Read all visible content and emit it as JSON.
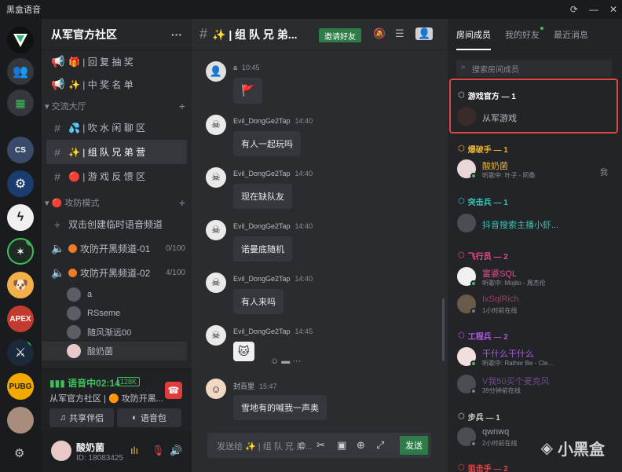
{
  "window": {
    "title": "黑盒语音",
    "controls": [
      "refresh-icon",
      "minimize-icon",
      "close-icon"
    ]
  },
  "rail": {
    "servers": [
      {
        "name": "heybox-logo",
        "bg": "#111"
      },
      {
        "name": "friends",
        "bg": "#35373c"
      },
      {
        "name": "game-lobby",
        "bg": "#35373c"
      },
      {
        "name": "cs",
        "bg": "#3a4a6a"
      },
      {
        "name": "steam",
        "bg": "#1b3c6e"
      },
      {
        "name": "lightning",
        "bg": "#f0f0f0"
      },
      {
        "name": "congjun",
        "bg": "#1f2a22"
      },
      {
        "name": "doge",
        "bg": "#f3b04a"
      },
      {
        "name": "apex",
        "bg": "#c33a2e"
      },
      {
        "name": "destiny",
        "bg": "#1a2a3a"
      },
      {
        "name": "pubg",
        "bg": "#f2a900"
      },
      {
        "name": "portrait",
        "bg": "#a88d7d"
      }
    ],
    "apex_label": "APEX",
    "pubg_label": "PUBG"
  },
  "channels": {
    "server_title": "从军官方社区",
    "more": "···",
    "items": [
      {
        "label": "🎁 | 回 复 抽 奖",
        "type": "text"
      },
      {
        "label": "✨ | 中 奖 名 单",
        "type": "text"
      }
    ],
    "cat_hall": "交流大厅",
    "hall": [
      {
        "label": "💦 | 吹 水 闲 聊 区"
      },
      {
        "label": "✨ | 组 队 兄 弟 营"
      },
      {
        "label": "🔴 | 游 戏 反 馈 区"
      }
    ],
    "cat_attack": "攻防模式",
    "create_temp": "双击创建临时语音频道",
    "voice1": {
      "label": "攻防开黑频道-01",
      "count": "0/100"
    },
    "voice2": {
      "label": "攻防开黑频道-02",
      "count": "4/100"
    },
    "members": [
      "a",
      "RSseme",
      "随风渐远00",
      "酸奶菌"
    ]
  },
  "voice": {
    "status": "语音中02:14",
    "kbps": "128K",
    "location": "从军官方社区 | 🟠 攻防开黑...",
    "share": "共享伴侣",
    "pack": "语音包"
  },
  "user": {
    "name": "酸奶菌",
    "id": "ID: 18083425"
  },
  "chat": {
    "channel": "✨ | 组 队 兄 弟...",
    "invite": "邀请好友",
    "input_placeholder": "发送给 ✨ | 组 队 兄 弟...",
    "send": "发送",
    "messages": [
      {
        "user": "a",
        "time": "10:45",
        "text": "🚩"
      },
      {
        "user": "Evil_DongGe2Tap",
        "time": "14:40",
        "text": "有人一起玩吗"
      },
      {
        "user": "Evil_DongGe2Tap",
        "time": "14:40",
        "text": "现在缺队友"
      },
      {
        "user": "Evil_DongGe2Tap",
        "time": "14:40",
        "text": "诺曼底随机"
      },
      {
        "user": "Evil_DongGe2Tap",
        "time": "14:40",
        "text": "有人来吗"
      },
      {
        "user": "Evil_DongGe2Tap",
        "time": "14:45",
        "text": "🐱"
      },
      {
        "user": "封百里",
        "time": "15:47",
        "text": "雪地有的喊我一声奥"
      }
    ]
  },
  "right": {
    "tabs": [
      "房间成员",
      "我的好友",
      "最近消息"
    ],
    "search_placeholder": "搜索房间成员",
    "groups": [
      {
        "title": "游戏官方 — 1",
        "color": "#ffffff",
        "members": [
          {
            "name": "从军游戏",
            "status": "",
            "color": "#b8bbbf",
            "online": false
          }
        ]
      },
      {
        "title": "爆破手 — 1",
        "color": "#e8b43c",
        "members": [
          {
            "name": "酸奶菌",
            "status": "听歌中: 叶子 - 阿桑",
            "color": "#e8b43c",
            "online": true
          }
        ]
      },
      {
        "title": "突击兵 — 1",
        "color": "#3cc1b4",
        "members": [
          {
            "name": "抖音搜索主播小虾...",
            "status": "",
            "color": "#3cc1b4",
            "online": false
          }
        ]
      },
      {
        "title": "飞行员 — 2",
        "color": "#e0508a",
        "members": [
          {
            "name": "富婆SQL",
            "status": "听歌中: Mojito - 周杰伦",
            "color": "#e0508a",
            "online": true
          },
          {
            "name": "IxSqlRich",
            "status": "1小时前在线",
            "color": "#9b3c63",
            "online": false
          }
        ]
      },
      {
        "title": "工程兵 — 2",
        "color": "#a65cd8",
        "members": [
          {
            "name": "干什么干什么",
            "status": "听歌中: Rather Be - Cle...",
            "color": "#a65cd8",
            "online": true
          },
          {
            "name": "V我50买个麦克风",
            "status": "39分钟前在线",
            "color": "#6d4b86",
            "online": false
          }
        ]
      },
      {
        "title": "步兵 — 1",
        "color": "#d0d2d5",
        "members": [
          {
            "name": "qwnwq",
            "status": "2小时前在线",
            "color": "#9a9da2",
            "online": false
          }
        ]
      },
      {
        "title": "狙击手 — 2",
        "color": "#e04646",
        "members": []
      }
    ],
    "side_note": "我",
    "watermark": "小黑盒"
  }
}
